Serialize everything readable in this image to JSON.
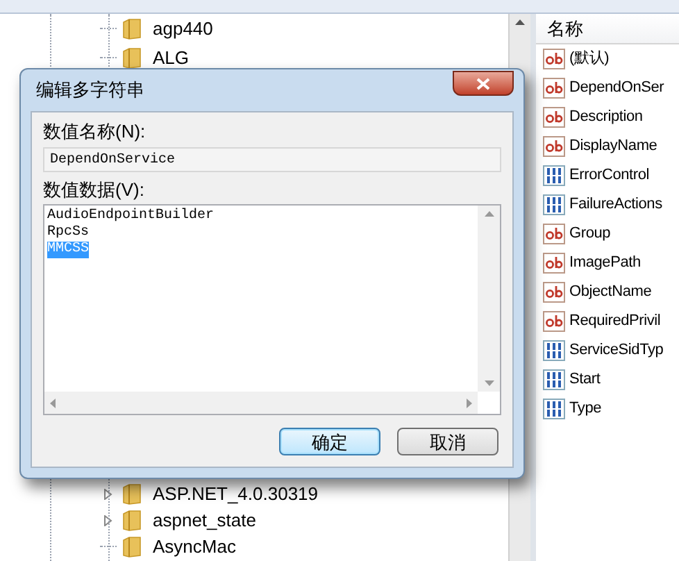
{
  "tree": {
    "items": [
      {
        "label": "agp440",
        "expandable": false
      },
      {
        "label": "ALG",
        "expandable": false
      }
    ],
    "items_below": [
      {
        "label": "ASP.NET_4.0.30319",
        "expandable": true
      },
      {
        "label": "aspnet_state",
        "expandable": true
      },
      {
        "label": "AsyncMac",
        "expandable": false
      }
    ]
  },
  "values": {
    "header": "名称",
    "items": [
      {
        "kind": "string",
        "name": "(默认)"
      },
      {
        "kind": "string",
        "name": "DependOnSer"
      },
      {
        "kind": "string",
        "name": "Description"
      },
      {
        "kind": "string",
        "name": "DisplayName"
      },
      {
        "kind": "binary",
        "name": "ErrorControl"
      },
      {
        "kind": "binary",
        "name": "FailureActions"
      },
      {
        "kind": "string",
        "name": "Group"
      },
      {
        "kind": "string",
        "name": "ImagePath"
      },
      {
        "kind": "string",
        "name": "ObjectName"
      },
      {
        "kind": "string",
        "name": "RequiredPrivil"
      },
      {
        "kind": "binary",
        "name": "ServiceSidTyp"
      },
      {
        "kind": "binary",
        "name": "Start"
      },
      {
        "kind": "binary",
        "name": "Type"
      }
    ]
  },
  "dialog": {
    "title": "编辑多字符串",
    "name_label": "数值名称(N):",
    "name_value": "DependOnService",
    "data_label": "数值数据(V):",
    "data_lines": [
      {
        "text": "AudioEndpointBuilder",
        "selected": false
      },
      {
        "text": "RpcSs",
        "selected": false
      },
      {
        "text": "MMCSS",
        "selected": true
      }
    ],
    "ok": "确定",
    "cancel": "取消"
  }
}
